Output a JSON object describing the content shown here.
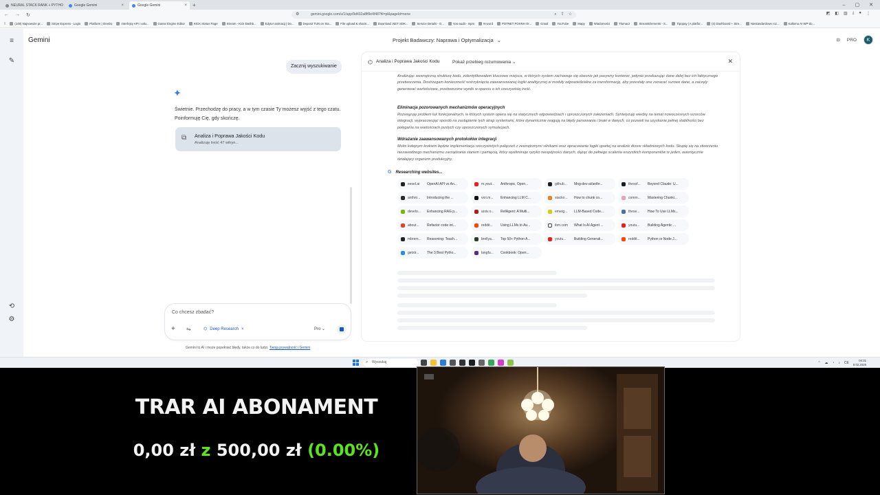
{
  "browser": {
    "tabs": [
      {
        "label": "NEURAL STACK RANK + PYTHON RU",
        "active": false
      },
      {
        "label": "Google Gemini",
        "active": false
      },
      {
        "label": "Google Gemini",
        "active": true
      }
    ],
    "url": "gemini.google.com/u/1/app/9d432a8ff9e4f48?hl=pl&pageId=none",
    "bookmarks": [
      "(149) Najnowsze pr...",
      "Stripe Express - Login",
      "Platform | OneDo",
      "Interfejsy API i usłu...",
      "Gasse Engine Editor",
      "KICK Status Page",
      "Stream - Kick Dashb...",
      "Edytor animacji | Do...",
      "Deposit TUN on Sta...",
      "File upload & sharin...",
      "Download .NET SDK...",
      "Service Details - G...",
      "Vos-audit - mpm",
      "N-word",
      "POTNET POSNH Or...",
      "Gmail",
      "YouTube",
      "Mapy",
      "Wiadomości",
      "Tłumacz",
      "StreamElements - S...",
      "Tipopay | A platfor...",
      "(4) Dashboard + Stre...",
      "Niestandardowe roz...",
      "Kalkeno AI WP-do..."
    ]
  },
  "app": {
    "brand": "Gemini",
    "project_title": "Projekt Badawczy: Naprawa i Optymalizacja",
    "plan_badge": "PRO",
    "avatar_initial": "K"
  },
  "chat": {
    "user_message": "Zacznij wyszukiwanie",
    "reply": "Świetnie. Przechodzę do pracy, a w tym czasie Ty możesz wyjść z tego czatu. Poinformuję Cię, gdy skończę.",
    "task_card": {
      "title": "Analiza i Poprawa Jakości Kodu",
      "subtitle": "Analizuję treść 47 witryn..."
    },
    "input_placeholder": "Co chcesz zbadać?",
    "deep_research_chip": "Deep Research",
    "mode": "Pro",
    "disclaimer": "Gemini to AI i może popełniać błędy, także co do ludzi.",
    "disclaimer_link": "Twoja prywatność i Gemini"
  },
  "panel": {
    "title": "Analiza i Poprawa Jakości Kodu",
    "reasoning_toggle": "Pokaż przebieg rozumowania",
    "sections": [
      {
        "heading": "",
        "body": "Analizując wewnętrzną strukturę kodu, zidentyfikowałem kluczowe miejsca, w których system zachowuje się obecnie jak pasywny kontener, jedynie przekazując dane dalej bez ich faktycznego przetworzenia. Dostrzegam konieczność wstrzyknięcia zaawansowanej logiki analitycznej w moduły odpowiedzialne za transformację, aby przestały one zwracać surowe dane, a zaczęły generować wartościowe, przetworzone wyniki w oparciu o ich rzeczywistą treść."
      },
      {
        "heading": "Eliminacja pozorowanych mechanizmów operacyjnych",
        "body": "Rozwiązuję problem luk funkcjonalnych, w których system opiera się na statycznych odpowiedziach i uproszczonych założeniach. Syntetyzuję wiedzę na temat nowoczesnych wzorców integracji, wypracowując sposób na zastąpienie tych atrap systemami, które dynamicznie reagują na błędy parsowania i braki w danych, co pozwoli na uzyskanie pełnej stabilności bez polegania na wartościach pustych czy uproszczonych symulacjach."
      },
      {
        "heading": "Wdrażanie zaawansowanych protokołów integracji",
        "body": "Moim kolejnym krokiem będzie implementacja rzeczywistych połączeń z zewnętrznymi silnikami oraz opracowanie logiki opartej na analizie drzew składniowych kodu. Skupię się na stworzeniu niezawodnego mechanizmu zarządzania stanem i pamięcią, który wyeliminuje ryzyko niespójności danych, dążąc do pełnego scalenia wszystkich komponentów w jeden, autentycznie działający organizm produkcyjny."
      }
    ],
    "researching_label": "Researching websites...",
    "sites": [
      {
        "domain": "eesel.ai",
        "title": "OpenAI API vs An...",
        "color": "#222222"
      },
      {
        "domain": "m.yout...",
        "title": "Anthropic, Open...",
        "color": "#e62117"
      },
      {
        "domain": "github...",
        "title": "Mng-dev-ai/anthr...",
        "color": "#1b1f23"
      },
      {
        "domain": "thesof...",
        "title": "Beyond Claude: U...",
        "color": "#1b1f23"
      },
      {
        "domain": "anthro...",
        "title": "Introducing the ...",
        "color": "#2b2b2b"
      },
      {
        "domain": "vxri.m...",
        "title": "Enhancing LLM C...",
        "color": "#111111"
      },
      {
        "domain": "stacko...",
        "title": "How to chunk co...",
        "color": "#f48024"
      },
      {
        "domain": "comm...",
        "title": "Mastering Chunki...",
        "color": "#e9a3b3"
      },
      {
        "domain": "develo...",
        "title": "Enhancing RAG p...",
        "color": "#76b900"
      },
      {
        "domain": "arxiv.o...",
        "title": "RefAgent: A Multi...",
        "color": "#b31b1b"
      },
      {
        "domain": "emerg...",
        "title": "LLM-Based Code...",
        "color": "#e5c700"
      },
      {
        "domain": "these...",
        "title": "How To Use LLMs...",
        "color": "#4a6fa5"
      },
      {
        "domain": "about...",
        "title": "Refactor code int...",
        "color": "#e24329"
      },
      {
        "domain": "reddit...",
        "title": "Using LLMs to Au...",
        "color": "#ff4500"
      },
      {
        "domain": "ibm.com",
        "title": "What Is AI Agent ...",
        "color": "#ffffff"
      },
      {
        "domain": "youtu...",
        "title": "Building Agentic ...",
        "color": "#e62117"
      },
      {
        "domain": "mbrem...",
        "title": "Reasoning: Teach...",
        "color": "#222222"
      },
      {
        "domain": "brellya...",
        "title": "Top 50+ Python A...",
        "color": "#2c3e2a"
      },
      {
        "domain": "youtu...",
        "title": "Building Generati...",
        "color": "#e62117"
      },
      {
        "domain": "reddit...",
        "title": "Python or Node J...",
        "color": "#ff4500"
      },
      {
        "domain": "getstr...",
        "title": "The 3 Best Pytho...",
        "color": "#2a8ce8"
      },
      {
        "domain": "langfu...",
        "title": "Cookbook: Open...",
        "color": "#5a2d82"
      }
    ]
  },
  "taskbar": {
    "search_placeholder": "Wyszukaj",
    "time": "04:31",
    "date": "8.02.2026",
    "lang": "CE"
  },
  "overlay": {
    "subtitle": "TRAR AI ABONAMENT",
    "goal_current": "0,00 zł",
    "goal_sep": "z",
    "goal_target": "500,00 zł",
    "goal_percent": "(0.00%)"
  }
}
